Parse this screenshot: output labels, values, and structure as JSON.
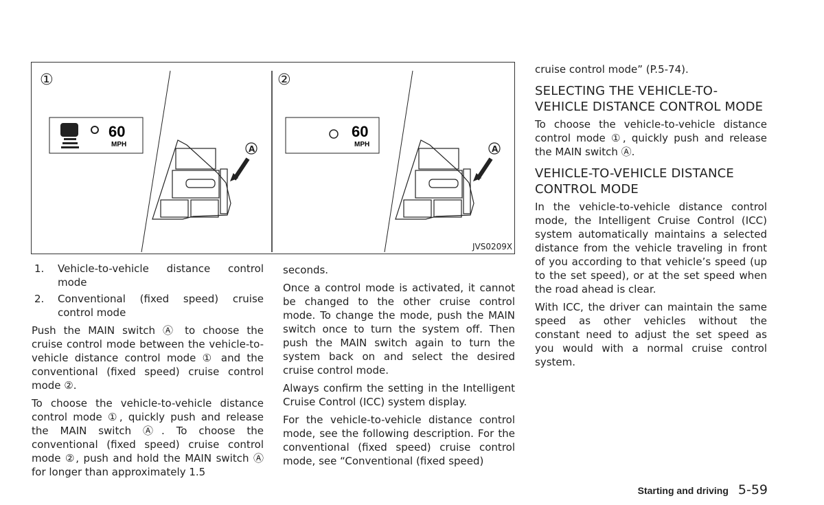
{
  "figure": {
    "panel1_label": "①",
    "panel2_label": "②",
    "callout": "A",
    "speed": "60",
    "unit": "MPH",
    "code": "JVS0209X"
  },
  "col1": {
    "list": [
      {
        "num": "1.",
        "text": "Vehicle-to-vehicle distance control mode"
      },
      {
        "num": "2.",
        "text": "Conventional (fixed speed) cruise control mode"
      }
    ],
    "paragraphs": [
      "Push the MAIN switch Ⓐ to choose the cruise control mode between the vehicle-to-vehicle distance control mode ① and the conventional (fixed speed) cruise control mode ②.",
      "To choose the vehicle-to-vehicle distance control mode ①, quickly push and release the MAIN switch Ⓐ. To choose the conventional (fixed speed) cruise control mode ②, push and hold the MAIN switch Ⓐ for longer than approximately 1.5"
    ]
  },
  "col2": {
    "paragraphs": [
      "seconds.",
      "Once a control mode is activated, it cannot be changed to the other cruise control mode. To change the mode, push the MAIN switch once to turn the system off. Then push the MAIN switch again to turn the system back on and select the desired cruise control mode.",
      "Always confirm the setting in the Intelligent Cruise Control (ICC) system display.",
      "For the vehicle-to-vehicle distance control mode, see the following description. For the conventional (fixed speed) cruise control mode, see “Conventional (fixed speed)"
    ]
  },
  "col3": {
    "intro": "cruise control mode” (P.5-74).",
    "heading1": "SELECTING THE VEHICLE-TO-VEHICLE DISTANCE CONTROL MODE",
    "p1": "To choose the vehicle-to-vehicle distance control mode ①, quickly push and release the MAIN switch Ⓐ.",
    "heading2": "VEHICLE-TO-VEHICLE DISTANCE CONTROL MODE",
    "p2": "In the vehicle-to-vehicle distance control mode, the Intelligent Cruise Control (ICC) system automatically maintains a selected distance from the vehicle traveling in front of you according to that vehicle’s speed (up to the set speed), or at the set speed when the road ahead is clear.",
    "p3": "With ICC, the driver can maintain the same speed as other vehicles without the constant need to adjust the set speed as you would with a normal cruise control system."
  },
  "footer": {
    "section": "Starting and driving",
    "page": "5-59"
  }
}
